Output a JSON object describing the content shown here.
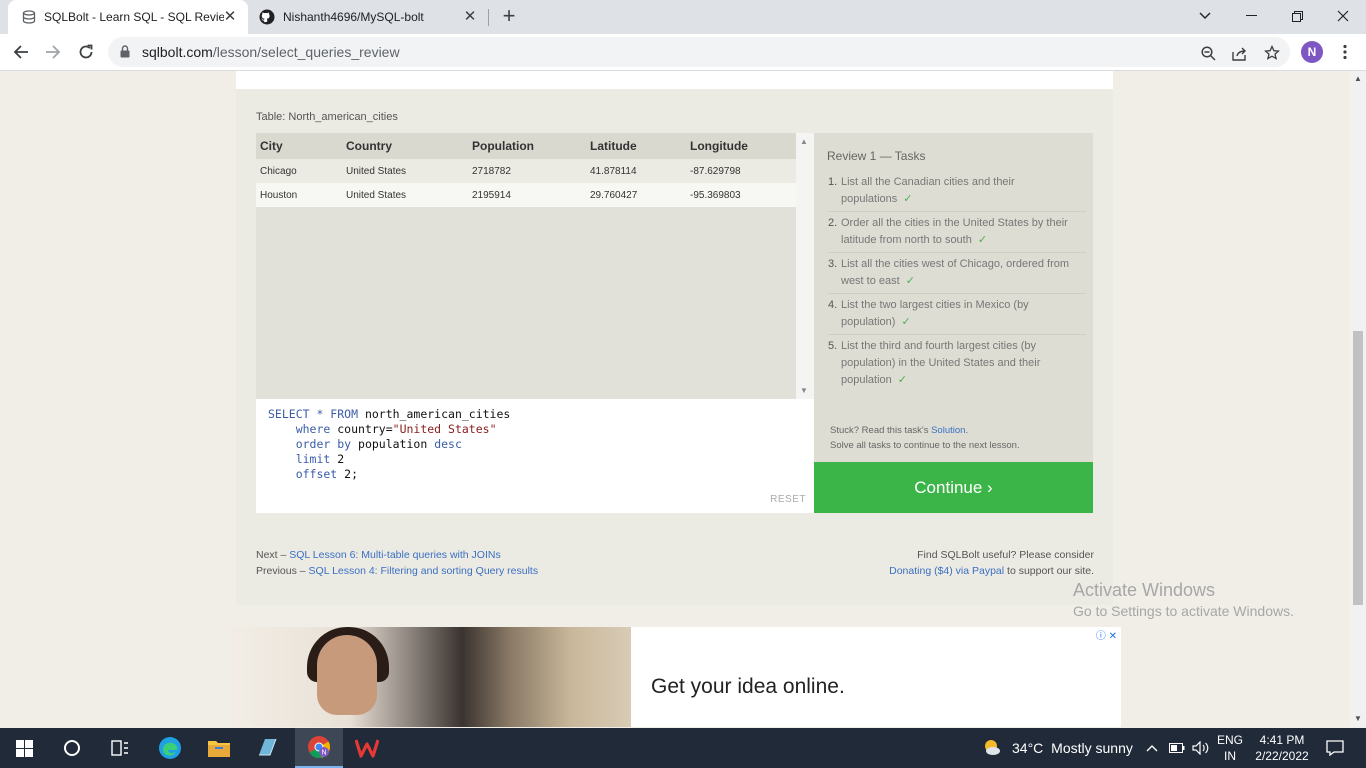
{
  "browser": {
    "tabs": [
      {
        "title": "SQLBolt - Learn SQL - SQL Review",
        "icon": "database-icon",
        "active": true
      },
      {
        "title": "Nishanth4696/MySQL-bolt",
        "icon": "github-icon",
        "active": false
      }
    ],
    "url_host": "sqlbolt.com",
    "url_path": "/lesson/select_queries_review",
    "profile_initial": "N"
  },
  "lesson": {
    "table_caption": "Table: North_american_cities",
    "columns": [
      "City",
      "Country",
      "Population",
      "Latitude",
      "Longitude"
    ],
    "rows": [
      [
        "Chicago",
        "United States",
        "2718782",
        "41.878114",
        "-87.629798"
      ],
      [
        "Houston",
        "United States",
        "2195914",
        "29.760427",
        "-95.369803"
      ]
    ],
    "query_lines": [
      {
        "parts": [
          {
            "k": "SELECT * FROM ",
            "t": "kw"
          },
          {
            "k": "north_american_cities",
            "t": "plain"
          }
        ]
      },
      {
        "parts": [
          {
            "k": "    where ",
            "t": "kw"
          },
          {
            "k": "country=",
            "t": "plain"
          },
          {
            "k": "\"United States\"",
            "t": "str"
          }
        ]
      },
      {
        "parts": [
          {
            "k": "    order by ",
            "t": "kw"
          },
          {
            "k": "population ",
            "t": "plain"
          },
          {
            "k": "desc",
            "t": "kw"
          }
        ]
      },
      {
        "parts": [
          {
            "k": "    limit ",
            "t": "kw"
          },
          {
            "k": "2",
            "t": "plain"
          }
        ]
      },
      {
        "parts": [
          {
            "k": "    offset ",
            "t": "kw"
          },
          {
            "k": "2;",
            "t": "plain"
          }
        ]
      }
    ],
    "reset_label": "RESET",
    "tasks_title": "Review 1 — Tasks",
    "tasks": [
      {
        "num": "1.",
        "text": "List all the Canadian cities and their populations",
        "done": "✓"
      },
      {
        "num": "2.",
        "text": "Order all the cities in the United States by their latitude from north to south",
        "done": "✓"
      },
      {
        "num": "3.",
        "text": "List all the cities west of Chicago, ordered from west to east",
        "done": "✓"
      },
      {
        "num": "4.",
        "text": "List the two largest cities in Mexico (by population)",
        "done": "✓"
      },
      {
        "num": "5.",
        "text": "List the third and fourth largest cities (by population) in the United States and their population",
        "done": "✓"
      }
    ],
    "stuck_text": "Stuck? Read this task's ",
    "solution_link": "Solution",
    "stuck_text_end": ".",
    "solve_all_text": "Solve all tasks to continue to the next lesson.",
    "continue_label": "Continue ›"
  },
  "footer": {
    "next_prefix": "Next – ",
    "next_link": "SQL Lesson 6: Multi-table queries with JOINs",
    "prev_prefix": "Previous – ",
    "prev_link": "SQL Lesson 4: Filtering and sorting Query results",
    "useful_text": "Find SQLBolt useful? Please consider",
    "donate_link": "Donating ($4) via Paypal",
    "donate_suffix": " to support our site."
  },
  "ad": {
    "headline": "Get your idea online.",
    "choices_icon": "ⓘ ✕"
  },
  "watermark": {
    "line1": "Activate Windows",
    "line2": "Go to Settings to activate Windows."
  },
  "taskbar": {
    "weather_temp": "34°C",
    "weather_desc": "Mostly sunny",
    "lang_top": "ENG",
    "lang_bottom": "IN",
    "time": "4:41 PM",
    "date": "2/22/2022"
  },
  "colors": {
    "continue_green": "#3cb548",
    "link_blue": "#3a6fc4",
    "keyword_blue": "#3a5da8",
    "string_red": "#8b1c1c",
    "check_green": "#4caf50"
  }
}
